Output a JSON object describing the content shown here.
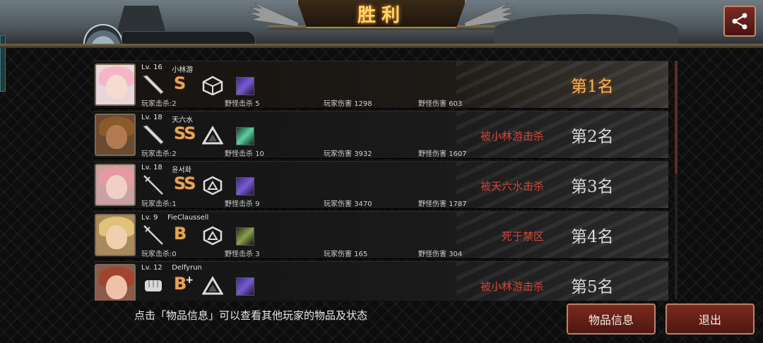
{
  "header": {
    "title": "胜利"
  },
  "share": {
    "icon": "share-icon"
  },
  "players": [
    {
      "level": "Lv. 16",
      "name": "小林游",
      "weapon_icon": "bat-icon",
      "grade": "S",
      "grade_sup": "",
      "armor_icon": "cube-armor-icon",
      "skill_icon": "purple-beast-skill-icon",
      "player_kills_label": "玩家击杀:",
      "player_kills": "2",
      "monster_kills_label": "野怪击杀",
      "monster_kills": "5",
      "player_damage_label": "玩家伤害",
      "player_damage": "1298",
      "monster_damage_label": "野怪伤害",
      "monster_damage": "603",
      "killed_by": "",
      "rank": "第1名"
    },
    {
      "level": "Lv. 18",
      "name": "天六水",
      "weapon_icon": "bat-icon",
      "grade": "SS",
      "grade_sup": "",
      "armor_icon": "triangle-armor-icon",
      "skill_icon": "green-blade-skill-icon",
      "player_kills_label": "玩家击杀:",
      "player_kills": "2",
      "monster_kills_label": "野怪击杀",
      "monster_kills": "10",
      "player_damage_label": "玩家伤害",
      "player_damage": "3932",
      "monster_damage_label": "野怪伤害",
      "monster_damage": "1607",
      "killed_by": "被小林游击杀",
      "rank": "第2名"
    },
    {
      "level": "Lv. 18",
      "name": "윤서화",
      "weapon_icon": "rapier-icon",
      "grade": "SS",
      "grade_sup": "",
      "armor_icon": "hex-armor-icon",
      "skill_icon": "purple-beast-skill-icon",
      "player_kills_label": "玩家击杀:",
      "player_kills": "1",
      "monster_kills_label": "野怪击杀",
      "monster_kills": "9",
      "player_damage_label": "玩家伤害",
      "player_damage": "3470",
      "monster_damage_label": "野怪伤害",
      "monster_damage": "1787",
      "killed_by": "被天六水击杀",
      "rank": "第3名"
    },
    {
      "level": "Lv. 9",
      "name": "FieClaussell",
      "weapon_icon": "rapier-icon",
      "grade": "B",
      "grade_sup": "",
      "armor_icon": "hex-armor-icon",
      "skill_icon": "dark-figure-skill-icon",
      "player_kills_label": "玩家击杀:",
      "player_kills": "0",
      "monster_kills_label": "野怪击杀",
      "monster_kills": "3",
      "player_damage_label": "玩家伤害",
      "player_damage": "165",
      "monster_damage_label": "野怪伤害",
      "monster_damage": "304",
      "killed_by": "死于禁区",
      "rank": "第4名"
    },
    {
      "level": "Lv. 12",
      "name": "Delfyrun",
      "weapon_icon": "fist-icon",
      "grade": "B",
      "grade_sup": "+",
      "armor_icon": "triangle-armor-icon",
      "skill_icon": "purple-beast-skill-icon",
      "player_kills_label": "",
      "player_kills": "",
      "monster_kills_label": "",
      "monster_kills": "",
      "player_damage_label": "",
      "player_damage": "",
      "monster_damage_label": "",
      "monster_damage": "",
      "killed_by": "被小林游击杀",
      "rank": "第5名"
    }
  ],
  "footer": {
    "hint": "点击「物品信息」可以查看其他玩家的物品及状态",
    "items_button": "物品信息",
    "exit_button": "退出"
  },
  "colors": {
    "accent_gold": "#f4b15a",
    "kill_red": "#d0463a",
    "button_red": "#7a2a1e"
  }
}
